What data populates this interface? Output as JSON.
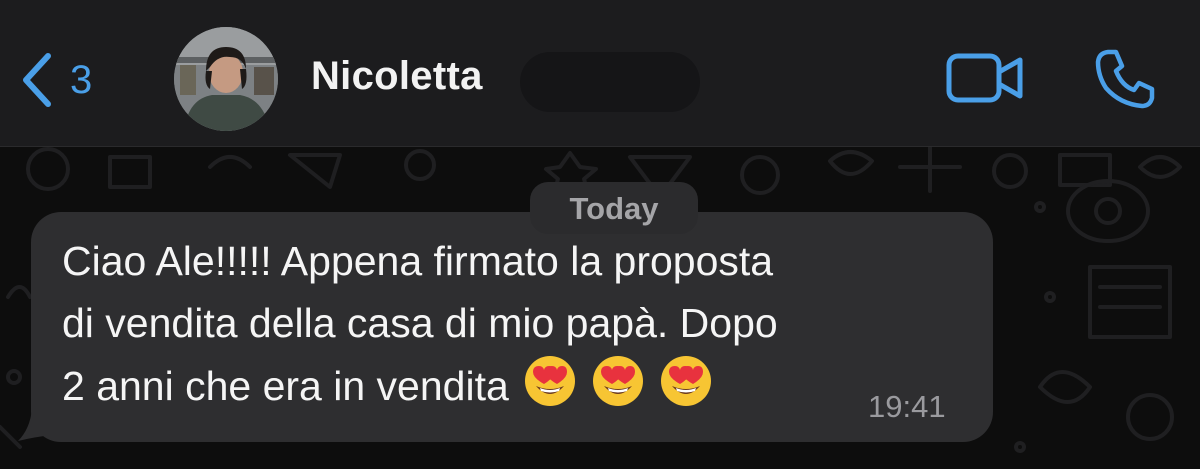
{
  "header": {
    "back_count": "3",
    "contact_name": "Nicoletta",
    "back_icon": "chevron-left-icon",
    "video_icon": "video-camera-icon",
    "call_icon": "phone-icon"
  },
  "chat": {
    "date_label": "Today",
    "message": {
      "line1": "Ciao Ale!!!!! Appena firmato la proposta",
      "line2": "di vendita della casa di mio papà. Dopo",
      "line3": "2 anni che era in vendita",
      "emojis": [
        "heart-eyes-emoji",
        "heart-eyes-emoji",
        "heart-eyes-emoji"
      ],
      "time": "19:41"
    }
  },
  "colors": {
    "accent": "#4a9fe8",
    "header_bg": "#1c1c1e",
    "bubble_bg": "#2e2e30",
    "chat_bg": "#0d0d0d"
  }
}
